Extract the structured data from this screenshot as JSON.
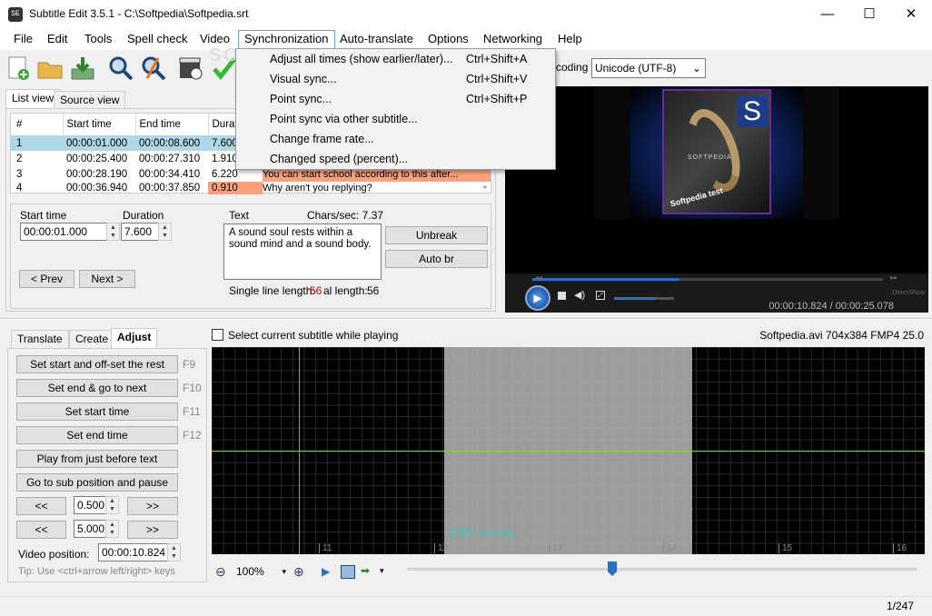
{
  "window": {
    "title": "Subtitle Edit 3.5.1 - C:\\Softpedia\\Softpedia.srt",
    "app_icon": "SE",
    "minimize_glyph": "—",
    "maximize_glyph": "☐",
    "close_glyph": "✕"
  },
  "menu": [
    "File",
    "Edit",
    "Tools",
    "Spell check",
    "Video",
    "Synchronization",
    "Auto-translate",
    "Options",
    "Networking",
    "Help"
  ],
  "sync_menu": [
    {
      "label": "Adjust all times (show earlier/later)...",
      "shortcut": "Ctrl+Shift+A"
    },
    {
      "label": "Visual sync...",
      "shortcut": "Ctrl+Shift+V"
    },
    {
      "label": "Point sync...",
      "shortcut": "Ctrl+Shift+P"
    },
    {
      "label": "Point sync via other subtitle...",
      "shortcut": ""
    },
    {
      "label": "Change frame rate...",
      "shortcut": ""
    },
    {
      "label": "Changed speed (percent)...",
      "shortcut": ""
    }
  ],
  "toolbar": {
    "encoding_label": "coding",
    "encoding_value": "Unicode (UTF-8)",
    "watermark": "SOFTPEDIA"
  },
  "tabs_top": {
    "list_view": "List view",
    "source_view": "Source view"
  },
  "list": {
    "headers": [
      "#",
      "Start time",
      "End time",
      "Durat"
    ],
    "rows": [
      {
        "num": "1",
        "start": "00:00:01.000",
        "end": "00:00:08.600",
        "dur": "7.600",
        "text": ""
      },
      {
        "num": "2",
        "start": "00:00:25.400",
        "end": "00:00:27.310",
        "dur": "1.910",
        "text": ""
      },
      {
        "num": "3",
        "start": "00:00:28.190",
        "end": "00:00:34.410",
        "dur": "6.220",
        "text": "You can start school according to this after..."
      },
      {
        "num": "4",
        "start": "00:00:36.940",
        "end": "00:00:37.850",
        "dur": "0.910",
        "text": "Why aren't you replying?"
      }
    ]
  },
  "editor": {
    "start_label": "Start time",
    "start_value": "00:00:01.000",
    "duration_label": "Duration",
    "duration_value": "7.600",
    "text_label": "Text",
    "chars_sec": "Chars/sec: 7.37",
    "text_value": "A sound soul rests within a sound mind and a sound body.",
    "unbreak": "Unbreak",
    "auto_br": "Auto br",
    "prev": "< Prev",
    "next": "Next >",
    "single_line_label": "Single line length:",
    "single_line_value": "56",
    "total_label": "al length:",
    "total_value": "56"
  },
  "video": {
    "time": "00:00:10.824 / 00:00:25.078",
    "cover_letter": "S",
    "cover_brand": "SOFTPEDIA",
    "cover_caption": "Softpedia test",
    "renderer": "DirectShow"
  },
  "tabs_bottom": {
    "translate": "Translate",
    "create": "Create",
    "adjust": "Adjust"
  },
  "adjust": {
    "buttons": [
      {
        "label": "Set start and off-set the rest",
        "key": "F9"
      },
      {
        "label": "Set end & go to next",
        "key": "F10"
      },
      {
        "label": "Set start time",
        "key": "F11"
      },
      {
        "label": "Set end time",
        "key": "F12"
      }
    ],
    "play_before": "Play from just before text",
    "go_to_sub": "Go to sub position and pause",
    "back": "<<",
    "fwd": ">>",
    "step1": "0.500",
    "step2": "5.000",
    "video_pos_label": "Video position:",
    "video_pos_value": "00:00:10.824",
    "tip": "Tip: Use <ctrl+arrow left/right> keys"
  },
  "waveform": {
    "select_current": "Select current subtitle while playing",
    "file_info": "Softpedia.avi 704x384 FMP4 25.0",
    "selection_label": "2.167 seconds",
    "ticks": [
      "11",
      "12",
      "13",
      "14",
      "15",
      "16"
    ],
    "zoom": "100%"
  },
  "status": {
    "count": "1/247"
  },
  "colors": {
    "accent": "#cce8ff",
    "row_selected": "#add8e6",
    "warn": "#ffa07a",
    "link_red": "#cc0000",
    "wave_green": "#39c96a"
  }
}
